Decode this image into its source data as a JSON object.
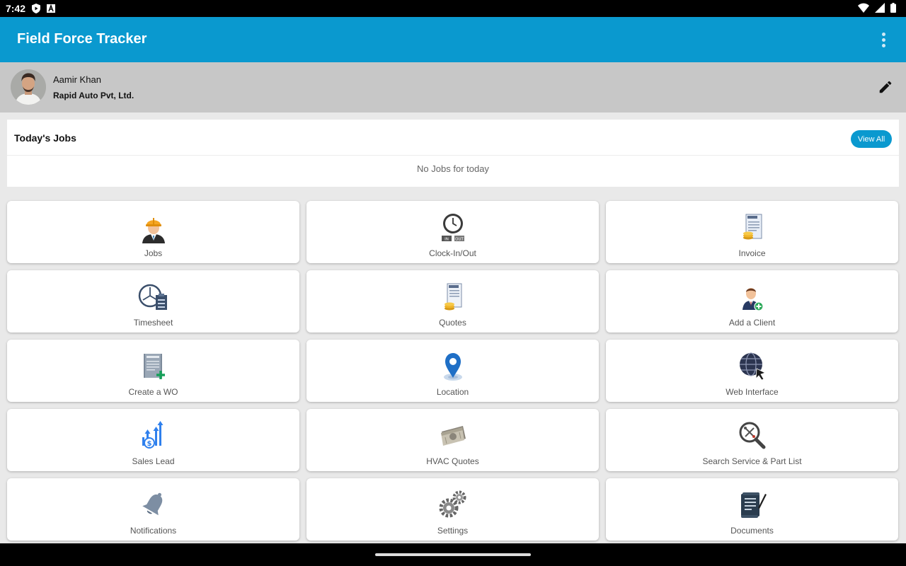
{
  "status_bar": {
    "time": "7:42",
    "icons_left": [
      "shield-play-icon",
      "font-a-icon"
    ],
    "icons_right": [
      "wifi-icon",
      "signal-icon",
      "battery-icon"
    ]
  },
  "app_bar": {
    "title": "Field Force Tracker",
    "menu_icon": "more-vertical-icon"
  },
  "profile": {
    "name": "Aamir Khan",
    "company": "Rapid Auto Pvt, Ltd.",
    "edit_icon": "pencil-icon"
  },
  "todays_jobs": {
    "title": "Today's Jobs",
    "view_all_label": "View All",
    "empty_message": "No Jobs for today"
  },
  "tiles": [
    {
      "label": "Jobs",
      "icon": "worker-icon"
    },
    {
      "label": "Clock-In/Out",
      "icon": "clock-in-out-icon"
    },
    {
      "label": "Invoice",
      "icon": "invoice-icon"
    },
    {
      "label": "Timesheet",
      "icon": "timesheet-icon"
    },
    {
      "label": "Quotes",
      "icon": "quotes-icon"
    },
    {
      "label": "Add a Client",
      "icon": "add-client-icon"
    },
    {
      "label": "Create a WO",
      "icon": "create-wo-icon"
    },
    {
      "label": "Location",
      "icon": "location-pin-icon"
    },
    {
      "label": "Web Interface",
      "icon": "globe-cursor-icon"
    },
    {
      "label": "Sales Lead",
      "icon": "sales-chart-icon"
    },
    {
      "label": "HVAC Quotes",
      "icon": "cash-icon"
    },
    {
      "label": "Search Service & Part List",
      "icon": "search-tools-icon"
    },
    {
      "label": "Notifications",
      "icon": "bell-icon"
    },
    {
      "label": "Settings",
      "icon": "gears-icon"
    },
    {
      "label": "Documents",
      "icon": "document-scroll-icon"
    }
  ],
  "colors": {
    "primary": "#0a99cf",
    "profile_background": "#c7c7c7",
    "page_background": "#e9e9e9"
  }
}
